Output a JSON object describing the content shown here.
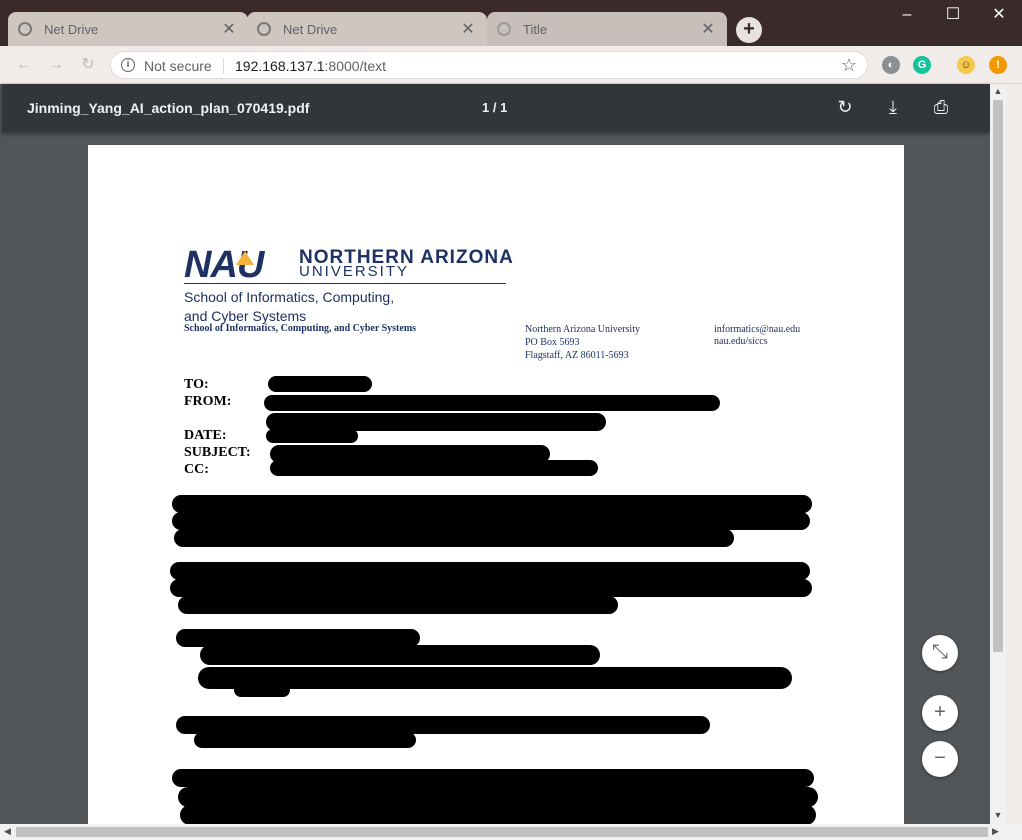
{
  "browser": {
    "tabs": [
      {
        "title": "Net Drive",
        "close": "✕"
      },
      {
        "title": "Net Drive",
        "close": "✕"
      },
      {
        "title": "Title",
        "close": "✕"
      }
    ],
    "new_tab": "+",
    "window_controls": {
      "minimize": "–",
      "maximize": "☐",
      "close": "✕"
    },
    "security_label": "Not secure",
    "url_host": "192.168.137.1",
    "url_path": ":8000/text"
  },
  "pdf_viewer": {
    "filename": "Jinming_Yang_AI_action_plan_070419.pdf",
    "page_indicator": "1 / 1",
    "tools": {
      "rotate": "↻",
      "download": "⤓",
      "print": "⎙"
    },
    "zoom": {
      "fit": "⤡",
      "zoom_in": "+",
      "zoom_out": "−"
    }
  },
  "document": {
    "logo": {
      "mark": "NAU",
      "line1": "NORTHERN ARIZONA",
      "line2": "UNIVERSITY",
      "dept_line1": "School of Informatics, Computing,",
      "dept_line2": "and Cyber Systems"
    },
    "dept_bold": "School of Informatics, Computing, and Cyber Systems",
    "address": [
      "Northern Arizona University",
      "PO Box 5693",
      "Flagstaff, AZ 86011-5693"
    ],
    "contact": [
      "informatics@nau.edu",
      "nau.edu/siccs"
    ],
    "memo_labels": {
      "to": "TO:",
      "from": "FROM:",
      "date": "DATE:",
      "subject": "SUBJECT:",
      "cc": "CC:"
    }
  }
}
